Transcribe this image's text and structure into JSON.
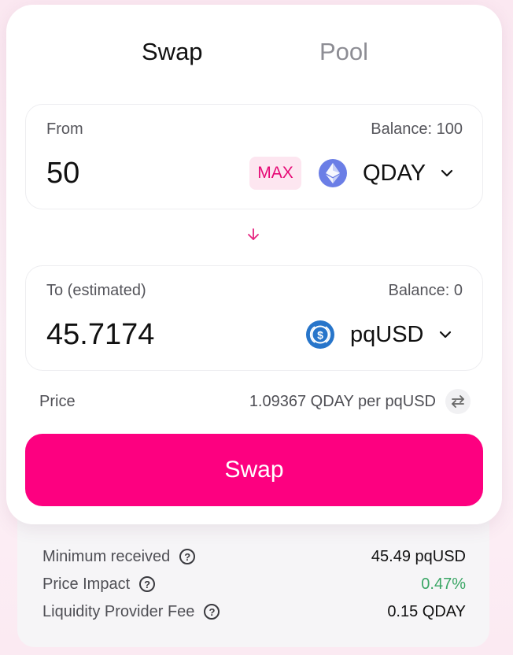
{
  "tabs": {
    "swap": "Swap",
    "pool": "Pool"
  },
  "from": {
    "label": "From",
    "balance": "Balance: 100",
    "amount": "50",
    "max_label": "MAX",
    "token": "QDAY",
    "token_icon": "ethereum-icon"
  },
  "to": {
    "label": "To (estimated)",
    "balance": "Balance: 0",
    "amount": "45.7174",
    "token": "pqUSD",
    "token_icon": "usdc-dollar-icon"
  },
  "price": {
    "label": "Price",
    "value": "1.09367 QDAY per pqUSD"
  },
  "swap_button": "Swap",
  "details": [
    {
      "label": "Minimum received",
      "value": "45.49 pqUSD"
    },
    {
      "label": "Price Impact",
      "value": "0.47%"
    },
    {
      "label": "Liquidity Provider Fee",
      "value": "0.15 QDAY"
    }
  ],
  "colors": {
    "accent": "#fd0080",
    "max_bg": "#fde6f0",
    "max_text": "#e60a76",
    "price_impact": "#3aa665",
    "eth_icon": "#6b7ee6",
    "usdc_icon": "#2775ca"
  }
}
